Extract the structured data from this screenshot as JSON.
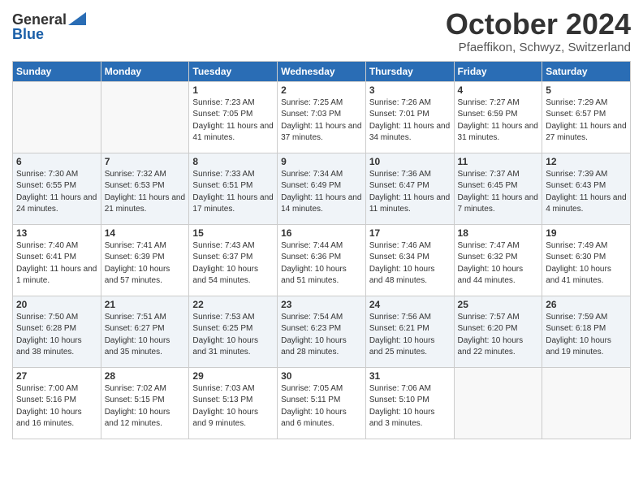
{
  "header": {
    "logo_general": "General",
    "logo_blue": "Blue",
    "month_title": "October 2024",
    "location": "Pfaeffikon, Schwyz, Switzerland"
  },
  "days_of_week": [
    "Sunday",
    "Monday",
    "Tuesday",
    "Wednesday",
    "Thursday",
    "Friday",
    "Saturday"
  ],
  "weeks": [
    [
      {
        "day": "",
        "info": ""
      },
      {
        "day": "",
        "info": ""
      },
      {
        "day": "1",
        "info": "Sunrise: 7:23 AM\nSunset: 7:05 PM\nDaylight: 11 hours and 41 minutes."
      },
      {
        "day": "2",
        "info": "Sunrise: 7:25 AM\nSunset: 7:03 PM\nDaylight: 11 hours and 37 minutes."
      },
      {
        "day": "3",
        "info": "Sunrise: 7:26 AM\nSunset: 7:01 PM\nDaylight: 11 hours and 34 minutes."
      },
      {
        "day": "4",
        "info": "Sunrise: 7:27 AM\nSunset: 6:59 PM\nDaylight: 11 hours and 31 minutes."
      },
      {
        "day": "5",
        "info": "Sunrise: 7:29 AM\nSunset: 6:57 PM\nDaylight: 11 hours and 27 minutes."
      }
    ],
    [
      {
        "day": "6",
        "info": "Sunrise: 7:30 AM\nSunset: 6:55 PM\nDaylight: 11 hours and 24 minutes."
      },
      {
        "day": "7",
        "info": "Sunrise: 7:32 AM\nSunset: 6:53 PM\nDaylight: 11 hours and 21 minutes."
      },
      {
        "day": "8",
        "info": "Sunrise: 7:33 AM\nSunset: 6:51 PM\nDaylight: 11 hours and 17 minutes."
      },
      {
        "day": "9",
        "info": "Sunrise: 7:34 AM\nSunset: 6:49 PM\nDaylight: 11 hours and 14 minutes."
      },
      {
        "day": "10",
        "info": "Sunrise: 7:36 AM\nSunset: 6:47 PM\nDaylight: 11 hours and 11 minutes."
      },
      {
        "day": "11",
        "info": "Sunrise: 7:37 AM\nSunset: 6:45 PM\nDaylight: 11 hours and 7 minutes."
      },
      {
        "day": "12",
        "info": "Sunrise: 7:39 AM\nSunset: 6:43 PM\nDaylight: 11 hours and 4 minutes."
      }
    ],
    [
      {
        "day": "13",
        "info": "Sunrise: 7:40 AM\nSunset: 6:41 PM\nDaylight: 11 hours and 1 minute."
      },
      {
        "day": "14",
        "info": "Sunrise: 7:41 AM\nSunset: 6:39 PM\nDaylight: 10 hours and 57 minutes."
      },
      {
        "day": "15",
        "info": "Sunrise: 7:43 AM\nSunset: 6:37 PM\nDaylight: 10 hours and 54 minutes."
      },
      {
        "day": "16",
        "info": "Sunrise: 7:44 AM\nSunset: 6:36 PM\nDaylight: 10 hours and 51 minutes."
      },
      {
        "day": "17",
        "info": "Sunrise: 7:46 AM\nSunset: 6:34 PM\nDaylight: 10 hours and 48 minutes."
      },
      {
        "day": "18",
        "info": "Sunrise: 7:47 AM\nSunset: 6:32 PM\nDaylight: 10 hours and 44 minutes."
      },
      {
        "day": "19",
        "info": "Sunrise: 7:49 AM\nSunset: 6:30 PM\nDaylight: 10 hours and 41 minutes."
      }
    ],
    [
      {
        "day": "20",
        "info": "Sunrise: 7:50 AM\nSunset: 6:28 PM\nDaylight: 10 hours and 38 minutes."
      },
      {
        "day": "21",
        "info": "Sunrise: 7:51 AM\nSunset: 6:27 PM\nDaylight: 10 hours and 35 minutes."
      },
      {
        "day": "22",
        "info": "Sunrise: 7:53 AM\nSunset: 6:25 PM\nDaylight: 10 hours and 31 minutes."
      },
      {
        "day": "23",
        "info": "Sunrise: 7:54 AM\nSunset: 6:23 PM\nDaylight: 10 hours and 28 minutes."
      },
      {
        "day": "24",
        "info": "Sunrise: 7:56 AM\nSunset: 6:21 PM\nDaylight: 10 hours and 25 minutes."
      },
      {
        "day": "25",
        "info": "Sunrise: 7:57 AM\nSunset: 6:20 PM\nDaylight: 10 hours and 22 minutes."
      },
      {
        "day": "26",
        "info": "Sunrise: 7:59 AM\nSunset: 6:18 PM\nDaylight: 10 hours and 19 minutes."
      }
    ],
    [
      {
        "day": "27",
        "info": "Sunrise: 7:00 AM\nSunset: 5:16 PM\nDaylight: 10 hours and 16 minutes."
      },
      {
        "day": "28",
        "info": "Sunrise: 7:02 AM\nSunset: 5:15 PM\nDaylight: 10 hours and 12 minutes."
      },
      {
        "day": "29",
        "info": "Sunrise: 7:03 AM\nSunset: 5:13 PM\nDaylight: 10 hours and 9 minutes."
      },
      {
        "day": "30",
        "info": "Sunrise: 7:05 AM\nSunset: 5:11 PM\nDaylight: 10 hours and 6 minutes."
      },
      {
        "day": "31",
        "info": "Sunrise: 7:06 AM\nSunset: 5:10 PM\nDaylight: 10 hours and 3 minutes."
      },
      {
        "day": "",
        "info": ""
      },
      {
        "day": "",
        "info": ""
      }
    ]
  ]
}
